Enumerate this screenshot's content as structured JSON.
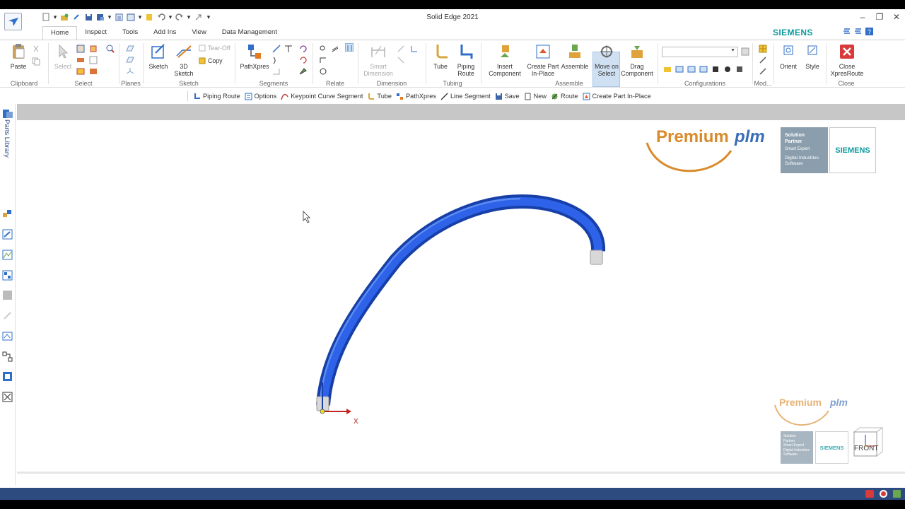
{
  "window": {
    "title": "Solid Edge 2021",
    "brand": "SIEMENS"
  },
  "tabs": [
    "Home",
    "Inspect",
    "Tools",
    "Add Ins",
    "View",
    "Data Management"
  ],
  "active_tab": "Home",
  "ribbon": {
    "clipboard": {
      "label": "Clipboard",
      "paste": "Paste"
    },
    "select": {
      "label": "Select",
      "select": "Select"
    },
    "planes": {
      "label": "Planes"
    },
    "sketch": {
      "label": "Sketch",
      "sketch": "Sketch",
      "sketch3d": "3D Sketch",
      "tear_off": "Tear-Off",
      "copy": "Copy"
    },
    "segments": {
      "label": "Segments",
      "pathxpres": "PathXpres"
    },
    "relate": {
      "label": "Relate"
    },
    "dimension": {
      "label": "Dimension",
      "smart_dimension": "Smart Dimension"
    },
    "tubing": {
      "label": "Tubing",
      "tube": "Tube",
      "piping_route": "Piping Route"
    },
    "assemble": {
      "label": "Assemble",
      "insert_component": "Insert Component",
      "create_part": "Create Part In-Place",
      "assemble": "Assemble",
      "move_on_select": "Move on Select",
      "drag_component": "Drag Component"
    },
    "configurations": {
      "label": "Configurations"
    },
    "modify": {
      "label": "Mod..."
    },
    "orient": {
      "orient": "Orient",
      "style": "Style"
    },
    "close": {
      "label": "Close",
      "close_xpresroute": "Close XpresRoute"
    }
  },
  "command_bar": [
    "Piping Route",
    "Options",
    "Keypoint Curve Segment",
    "Tube",
    "PathXpres",
    "Line Segment",
    "Save",
    "New",
    "Route",
    "Create Part In-Place"
  ],
  "left_panel": {
    "parts_library": "Parts Library"
  },
  "viewport": {
    "logo_premium": "Premium",
    "logo_plm": "plm",
    "partner_lines": [
      "Solution",
      "Partner",
      "Smart Expert",
      "Digital Industries",
      "Software"
    ],
    "partner_siemens": "SIEMENS",
    "view_label": "FRONT",
    "axis_label": "X"
  },
  "colors": {
    "tube": "#1f4fd6",
    "siemens_teal": "#0d9a9e",
    "statusbar": "#2e4b80",
    "premium_orange": "#d98b2b",
    "plm_blue": "#3a6db8"
  }
}
